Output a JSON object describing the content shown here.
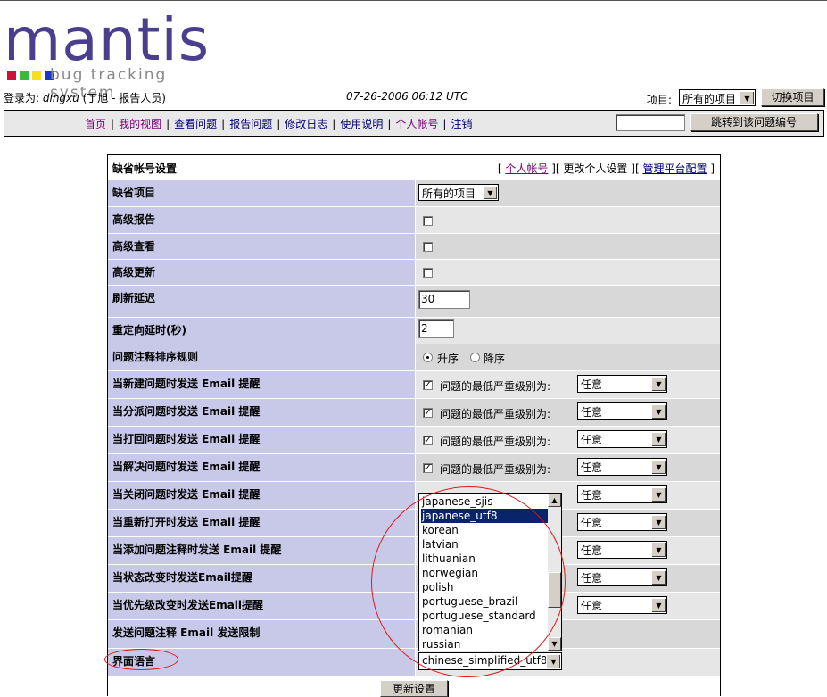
{
  "logo": {
    "word": "mantis",
    "tagline": "bug tracking system",
    "square_colors": [
      "#d0103a",
      "#3bb93b",
      "#f5e01b",
      "#1836c8"
    ]
  },
  "header": {
    "login_prefix": "登录为:",
    "username": "dingxu",
    "user_detail": "(丁旭 - 报告人员)",
    "datetime": "07-26-2006 06:12 UTC",
    "project_label": "项目:",
    "project_value": "所有的项目",
    "switch_button": "切换项目"
  },
  "menu": {
    "items": [
      "首页",
      "我的视图",
      "查看问题",
      "报告问题",
      "修改日志",
      "使用说明",
      "个人帐号",
      "注销"
    ],
    "jump_button": "跳转到该问题编号"
  },
  "prefs": {
    "title": "缺省帐号设置",
    "nav": {
      "bracket_open": "[",
      "my_account": "个人帐号",
      "mid1": "][",
      "change_prefs": "更改个人设置",
      "mid2": "][",
      "manage": "管理平台配置",
      "bracket_close": "]"
    },
    "labels": {
      "default_project": "缺省项目",
      "advanced_report": "高级报告",
      "advanced_view": "高级查看",
      "advanced_update": "高级更新",
      "refresh_delay": "刷新延迟",
      "redirect_delay": "重定向延时(秒)",
      "note_order": "问题注释排序规则",
      "email_new": "当新建问题时发送 Email 提醒",
      "email_assigned": "当分派问题时发送 Email 提醒",
      "email_feedback": "当打回问题时发送 Email 提醒",
      "email_resolved": "当解决问题时发送 Email 提醒",
      "email_closed": "当关闭问题时发送 Email 提醒",
      "email_reopened": "当重新打开时发送 Email 提醒",
      "email_bugnote": "当添加问题注释时发送 Email 提醒",
      "email_status": "当状态改变时发送Email提醒",
      "email_priority": "当优先级改变时发送Email提醒",
      "email_note_limit": "发送问题注释 Email 发送限制",
      "language": "界面语言"
    },
    "values": {
      "default_project": "所有的项目",
      "refresh_delay": "30",
      "redirect_delay": "2",
      "order_asc": "升序",
      "order_desc": "降序",
      "min_severity_label": "问题的最低严重级别为:",
      "severity_value": "任意",
      "language": "chinese_simplified_utf8"
    },
    "update_button": "更新设置"
  },
  "language_options": [
    "japanese_sjis",
    "japanese_utf8",
    "korean",
    "latvian",
    "lithuanian",
    "norwegian",
    "polish",
    "portuguese_brazil",
    "portuguese_standard",
    "romanian",
    "russian"
  ],
  "language_selected_option": "japanese_utf8"
}
